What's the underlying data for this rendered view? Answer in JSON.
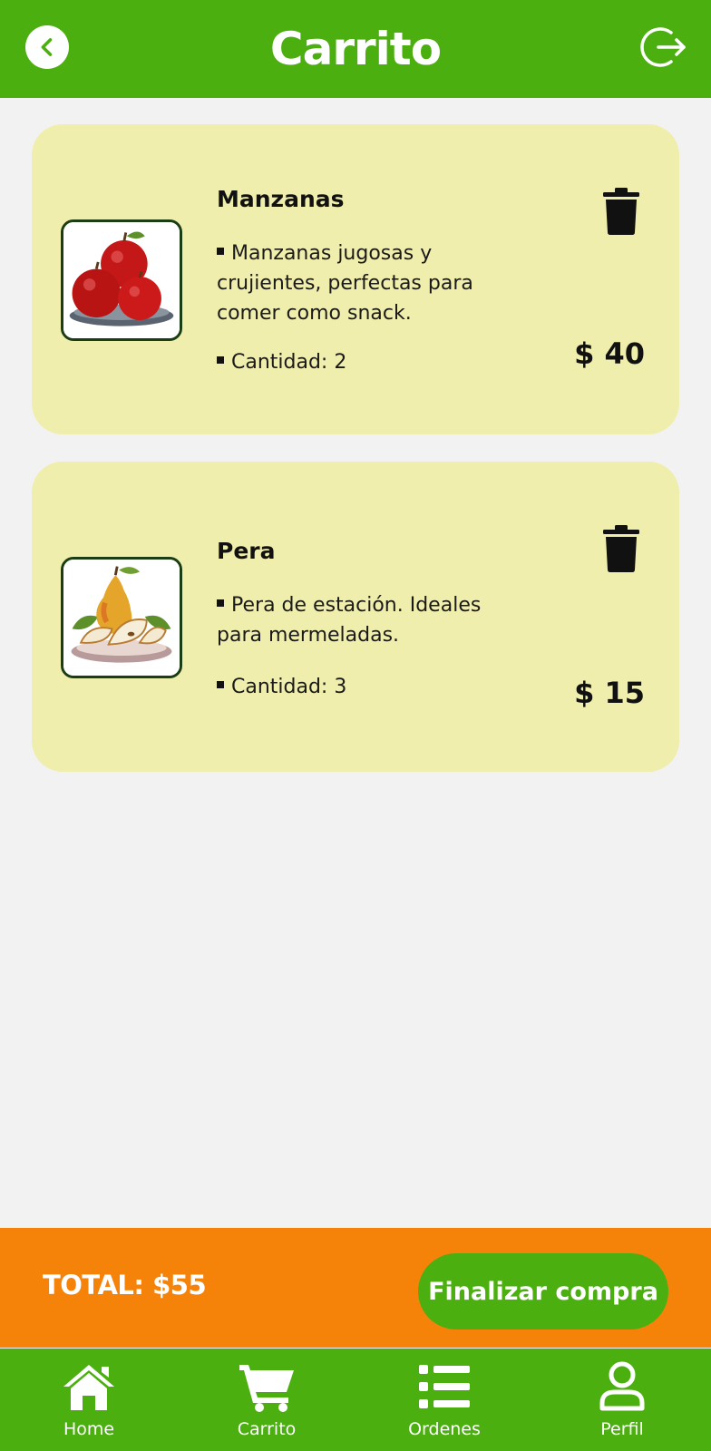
{
  "header": {
    "title": "Carrito"
  },
  "cart": {
    "items": [
      {
        "name": "Manzanas",
        "description": "Manzanas jugosas y crujientes, perfectas para comer como snack.",
        "quantity": "Cantidad: 2",
        "price": "$ 40"
      },
      {
        "name": "Pera",
        "description": "Pera de estación. Ideales para mermeladas.",
        "quantity": "Cantidad: 3",
        "price": "$ 15"
      }
    ]
  },
  "summary": {
    "total": "TOTAL: $55",
    "checkout_label": "Finalizar compra"
  },
  "nav": {
    "items": [
      {
        "label": "Home",
        "icon": "home-icon"
      },
      {
        "label": "Carrito",
        "icon": "cart-icon"
      },
      {
        "label": "Ordenes",
        "icon": "list-icon"
      },
      {
        "label": "Perfil",
        "icon": "user-icon"
      }
    ]
  },
  "colors": {
    "primary_green": "#4caf10",
    "accent_orange": "#f5830a",
    "card_bg": "#f0eeac",
    "page_bg": "#f2f2f2"
  }
}
